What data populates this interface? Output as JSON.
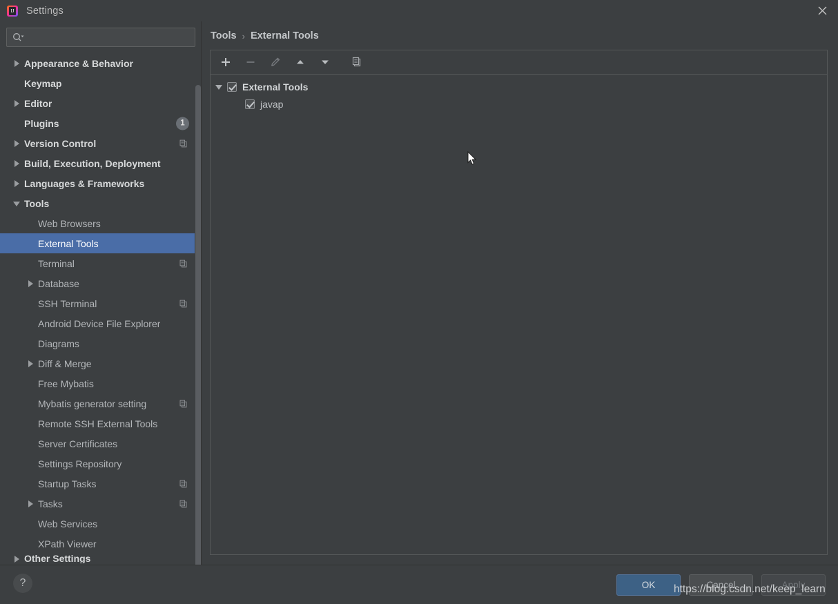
{
  "window": {
    "title": "Settings",
    "app_icon": "intellij-idea-icon",
    "close_icon": "close-icon"
  },
  "search": {
    "value": "",
    "placeholder": "",
    "icon": "search-icon"
  },
  "sidebar": {
    "items": [
      {
        "label": "Appearance & Behavior",
        "level": 0,
        "arrow": "right",
        "bold": true,
        "badge": null,
        "copy": false
      },
      {
        "label": "Keymap",
        "level": 0,
        "arrow": "none",
        "bold": true,
        "badge": null,
        "copy": false
      },
      {
        "label": "Editor",
        "level": 0,
        "arrow": "right",
        "bold": true,
        "badge": null,
        "copy": false
      },
      {
        "label": "Plugins",
        "level": 0,
        "arrow": "none",
        "bold": true,
        "badge": "1",
        "copy": false
      },
      {
        "label": "Version Control",
        "level": 0,
        "arrow": "right",
        "bold": true,
        "badge": null,
        "copy": true
      },
      {
        "label": "Build, Execution, Deployment",
        "level": 0,
        "arrow": "right",
        "bold": true,
        "badge": null,
        "copy": false
      },
      {
        "label": "Languages & Frameworks",
        "level": 0,
        "arrow": "right",
        "bold": true,
        "badge": null,
        "copy": false
      },
      {
        "label": "Tools",
        "level": 0,
        "arrow": "down",
        "bold": true,
        "badge": null,
        "copy": false
      },
      {
        "label": "Web Browsers",
        "level": 1,
        "arrow": "none",
        "bold": false,
        "badge": null,
        "copy": false
      },
      {
        "label": "External Tools",
        "level": 1,
        "arrow": "none",
        "bold": false,
        "badge": null,
        "copy": false,
        "selected": true
      },
      {
        "label": "Terminal",
        "level": 1,
        "arrow": "none",
        "bold": false,
        "badge": null,
        "copy": true
      },
      {
        "label": "Database",
        "level": 1,
        "arrow": "right",
        "bold": false,
        "badge": null,
        "copy": false
      },
      {
        "label": "SSH Terminal",
        "level": 1,
        "arrow": "none",
        "bold": false,
        "badge": null,
        "copy": true
      },
      {
        "label": "Android Device File Explorer",
        "level": 1,
        "arrow": "none",
        "bold": false,
        "badge": null,
        "copy": false
      },
      {
        "label": "Diagrams",
        "level": 1,
        "arrow": "none",
        "bold": false,
        "badge": null,
        "copy": false
      },
      {
        "label": "Diff & Merge",
        "level": 1,
        "arrow": "right",
        "bold": false,
        "badge": null,
        "copy": false
      },
      {
        "label": "Free Mybatis",
        "level": 1,
        "arrow": "none",
        "bold": false,
        "badge": null,
        "copy": false
      },
      {
        "label": "Mybatis generator setting",
        "level": 1,
        "arrow": "none",
        "bold": false,
        "badge": null,
        "copy": true
      },
      {
        "label": "Remote SSH External Tools",
        "level": 1,
        "arrow": "none",
        "bold": false,
        "badge": null,
        "copy": false
      },
      {
        "label": "Server Certificates",
        "level": 1,
        "arrow": "none",
        "bold": false,
        "badge": null,
        "copy": false
      },
      {
        "label": "Settings Repository",
        "level": 1,
        "arrow": "none",
        "bold": false,
        "badge": null,
        "copy": false
      },
      {
        "label": "Startup Tasks",
        "level": 1,
        "arrow": "none",
        "bold": false,
        "badge": null,
        "copy": true
      },
      {
        "label": "Tasks",
        "level": 1,
        "arrow": "right",
        "bold": false,
        "badge": null,
        "copy": true
      },
      {
        "label": "Web Services",
        "level": 1,
        "arrow": "none",
        "bold": false,
        "badge": null,
        "copy": false
      },
      {
        "label": "XPath Viewer",
        "level": 1,
        "arrow": "none",
        "bold": false,
        "badge": null,
        "copy": false
      },
      {
        "label": "Other Settings",
        "level": 0,
        "arrow": "right",
        "bold": true,
        "badge": null,
        "copy": false,
        "clipped": true
      }
    ]
  },
  "breadcrumb": {
    "parent": "Tools",
    "separator": "›",
    "current": "External Tools"
  },
  "toolbar": {
    "buttons": [
      {
        "name": "add-button",
        "icon": "plus-icon",
        "enabled": true
      },
      {
        "name": "remove-button",
        "icon": "minus-icon",
        "enabled": false
      },
      {
        "name": "edit-button",
        "icon": "pencil-icon",
        "enabled": false
      },
      {
        "name": "move-up-button",
        "icon": "arrow-up-icon",
        "enabled": true
      },
      {
        "name": "move-down-button",
        "icon": "arrow-down-icon",
        "enabled": true
      },
      {
        "name": "copy-button",
        "icon": "copy-icon",
        "enabled": true
      }
    ]
  },
  "tools_tree": {
    "group": {
      "label": "External Tools",
      "checked": true,
      "expanded": true
    },
    "children": [
      {
        "label": "javap",
        "checked": true
      }
    ]
  },
  "footer": {
    "help_label": "?",
    "ok_label": "OK",
    "cancel_label": "Cancel",
    "apply_label": "Apply"
  },
  "watermark": {
    "text": "https://blog.csdn.net/keep_learn"
  },
  "colors": {
    "window_bg": "#3c3f41",
    "selection_blue": "#4a6da7",
    "ok_button_blue": "#3d6185",
    "text_primary": "#b4b7ba",
    "text_bold": "#d7d9da",
    "border": "#555859"
  }
}
